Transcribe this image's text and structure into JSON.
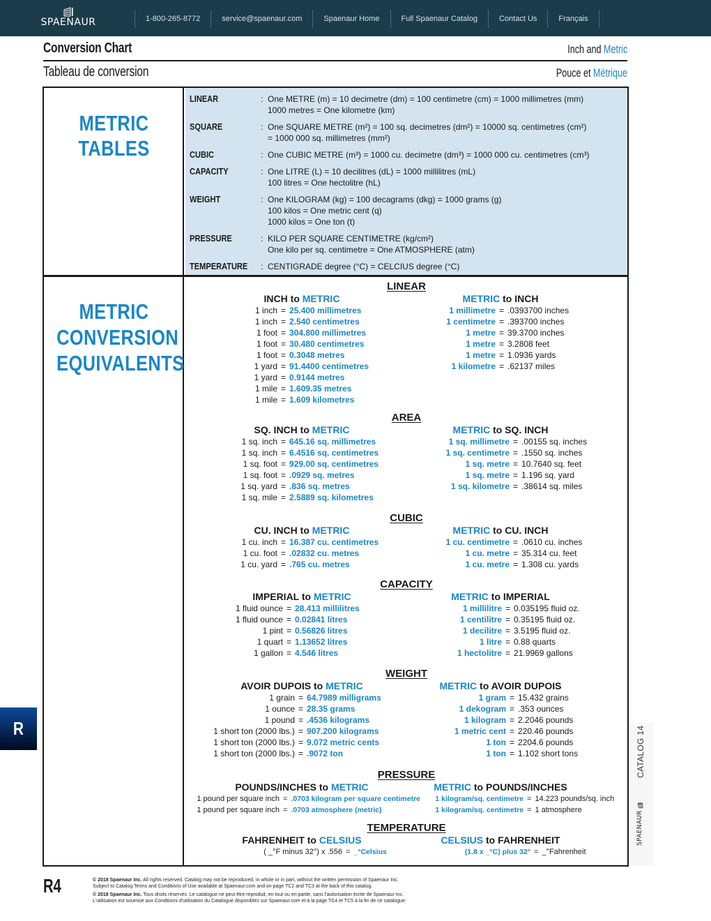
{
  "nav": {
    "brand": "SPAENAUR",
    "items": [
      "1-800-265-8772",
      "service@spaenaur.com",
      "Spaenaur Home",
      "Full Spaenaur Catalog",
      "Contact Us",
      "Français"
    ]
  },
  "header": {
    "title_en": "Conversion Chart",
    "title_fr": "Tableau de conversion",
    "subtitle_en": {
      "a": "Inch and ",
      "b": "Metric"
    },
    "subtitle_fr": {
      "a": "Pouce et ",
      "b": "Métrique"
    }
  },
  "colors": {
    "accent": "#1a86c8",
    "nav_bg": "#1b3c4a",
    "tables_bg": "#d3e3ef"
  },
  "metric_tables": {
    "heading": [
      "METRIC",
      "TABLES"
    ],
    "rows": [
      {
        "label": "LINEAR",
        "lines": [
          "One METRE (m) = 10 decimetre (dm) = 100 centimetre (cm) = 1000 millimetres (mm)",
          "1000 metres = One kilometre (km)"
        ]
      },
      {
        "label": "SQUARE",
        "lines": [
          "One SQUARE METRE (m²) = 100 sq. decimetres (dm²) = 10000 sq. centimetres (cm²)",
          "= 1000 000 sq. millimetres (mm²)"
        ]
      },
      {
        "label": "CUBIC",
        "lines": [
          "One CUBIC METRE (m³) = 1000 cu. decimetre (dm³) = 1000 000 cu. centimetres (cm³)"
        ]
      },
      {
        "label": "CAPACITY",
        "lines": [
          "One LITRE (L) = 10 decilitres (dL) = 1000 millilitres (mL)",
          "100 litres = One hectolitre (hL)"
        ]
      },
      {
        "label": "WEIGHT",
        "lines": [
          "One KILOGRAM (kg) = 100 decagrams (dkg) = 1000 grams (g)",
          "100 kilos = One metric cent (q)",
          "1000 kilos = One ton (t)"
        ]
      },
      {
        "label": "PRESSURE",
        "lines": [
          "KILO PER SQUARE CENTIMETRE (kg/cm²)",
          "One kilo per sq. centimetre = One ATMOSPHERE (atm)"
        ]
      },
      {
        "label": "TEMPERATURE",
        "lines": [
          "CENTIGRADE degree (°C) = CELCIUS degree (°C)"
        ]
      }
    ]
  },
  "equivalents": {
    "heading": [
      "METRIC",
      "CONVERSION",
      "EQUIVALENTS"
    ],
    "sections": [
      {
        "title": "LINEAR",
        "left_head": {
          "a": "INCH to ",
          "b": "METRIC"
        },
        "right_head": {
          "a": "METRIC",
          "b": " to INCH"
        },
        "left": [
          [
            "1 inch",
            "25.400 millimetres"
          ],
          [
            "1 inch",
            "2.540 centimetres"
          ],
          [
            "1 foot",
            "304.800 millimetres"
          ],
          [
            "1 foot",
            "30.480 centimetres"
          ],
          [
            "1 foot",
            "0.3048 metres"
          ],
          [
            "1 yard",
            "91.4400 centimetres"
          ],
          [
            "1 yard",
            "0.9144 metres"
          ],
          [
            "1 mile",
            "1.609.35 metres"
          ],
          [
            "1 mile",
            "1.609 kilometres"
          ]
        ],
        "right": [
          [
            "1 millimetre",
            ".0393700 inches"
          ],
          [
            "1 centimetre",
            " .393700 inches"
          ],
          [
            "1 metre",
            " 39.3700 inches"
          ],
          [
            "1 metre",
            " 3.2808 feet"
          ],
          [
            "1 metre",
            "1.0936 yards"
          ],
          [
            "1 kilometre",
            " .62137 miles"
          ]
        ]
      },
      {
        "title": "AREA",
        "left_head": {
          "a": "SQ. INCH to ",
          "b": "METRIC"
        },
        "right_head": {
          "a": "METRIC",
          "b": " to SQ. INCH"
        },
        "left": [
          [
            "1 sq. inch",
            "645.16 sq. millimetres"
          ],
          [
            "1 sq. inch",
            "6.4516 sq. centimetres"
          ],
          [
            "1 sq. foot",
            "929.00 sq. centimetres"
          ],
          [
            "1 sq. foot",
            ".0929 sq. metres"
          ],
          [
            "1 sq. yard",
            ".836 sq. metres"
          ],
          [
            "1 sq. mile",
            "2.5889 sq. kilometres"
          ]
        ],
        "right": [
          [
            "1 sq. millimetre",
            ".00155 sq. inches"
          ],
          [
            "1 sq. centimetre",
            ".1550 sq. inches"
          ],
          [
            "1 sq. metre",
            "10.7640 sq. feet"
          ],
          [
            "1 sq. metre",
            "1.196 sq. yard"
          ],
          [
            "1 sq. kilometre",
            ".38614 sq. miles"
          ]
        ]
      },
      {
        "title": "CUBIC",
        "left_head": {
          "a": "CU. INCH to ",
          "b": "METRIC"
        },
        "right_head": {
          "a": "METRIC",
          "b": " to CU. INCH"
        },
        "left": [
          [
            "1 cu. inch",
            "16.387 cu. centimetres"
          ],
          [
            "1 cu. foot",
            ".02832 cu. metres"
          ],
          [
            "1 cu. yard",
            ".765 cu. metres"
          ]
        ],
        "right": [
          [
            "1 cu. centimetre",
            ".0610 cu. inches"
          ],
          [
            "1 cu. metre",
            "35.314 cu. feet"
          ],
          [
            "1 cu. metre",
            "1.308 cu. yards"
          ]
        ]
      },
      {
        "title": "CAPACITY",
        "left_head": {
          "a": "IMPERIAL to ",
          "b": "METRIC"
        },
        "right_head": {
          "a": "METRIC",
          "b": " to IMPERIAL"
        },
        "left": [
          [
            "1 fluid ounce",
            "28.413 millilitres"
          ],
          [
            "1 fluid ounce",
            "0.02841 litres"
          ],
          [
            "1 pint",
            "0.56826 litres"
          ],
          [
            "1 quart",
            "1.13652 litres"
          ],
          [
            "1 gallon",
            "4.546 litres"
          ]
        ],
        "right": [
          [
            "1 millilitre",
            "0.035195 fluid oz."
          ],
          [
            "1 centilitre",
            "0.35195 fluid oz."
          ],
          [
            "1 decilitre",
            "3.5195 fluid oz."
          ],
          [
            "1 litre",
            "0.88 quarts"
          ],
          [
            "1 hectolitre",
            "21.9969 gallons"
          ]
        ]
      },
      {
        "title": "WEIGHT",
        "left_head": {
          "a": "AVOIR DUPOIS to ",
          "b": "METRIC"
        },
        "right_head": {
          "a": "METRIC",
          "b": " to AVOIR DUPOIS"
        },
        "left": [
          [
            "1 grain",
            "64.7989 milligrams"
          ],
          [
            "1 ounce",
            "28.35 grams"
          ],
          [
            "1 pound",
            ".4536 kilograms"
          ],
          [
            "1 short ton (2000 lbs.)",
            "907.200 kilograms"
          ],
          [
            "1 short ton (2000 lbs.)",
            "9.072 metric cents"
          ],
          [
            "1 short ton (2000 lbs.)",
            ".9072 ton"
          ]
        ],
        "right": [
          [
            "1 gram",
            "15.432 grains"
          ],
          [
            "1 dekogram",
            ".353 ounces"
          ],
          [
            "1 kilogram",
            "2.2046 pounds"
          ],
          [
            "1 metric cent",
            "220.46 pounds"
          ],
          [
            "1 ton",
            "2204.6 pounds"
          ],
          [
            "1 ton",
            "1.102 short tons"
          ]
        ]
      },
      {
        "title": "PRESSURE",
        "left_head": {
          "a": "POUNDS/INCHES to ",
          "b": "METRIC"
        },
        "right_head": {
          "a": "METRIC",
          "b": " to POUNDS/INCHES"
        },
        "left": [
          [
            "1 pound per square inch",
            ".0703 kilogram per square centimetre"
          ],
          [
            "1 pound per square inch",
            ".0703 atmosphere (metric)"
          ]
        ],
        "right": [
          [
            "1 kilogram/sq. centimetre",
            "14.223 pounds/sq. inch"
          ],
          [
            "1 kilogram/sq. centimetre",
            "1 atmosphere"
          ]
        ]
      },
      {
        "title": "TEMPERATURE",
        "left_head": {
          "a": "FAHRENHEIT to ",
          "b": "CELSIUS"
        },
        "right_head": {
          "a": "CELSIUS",
          "b": " to FAHRENHEIT"
        },
        "left": [
          [
            "( _°F minus 32°) x .556",
            "_°Celsius"
          ]
        ],
        "right": [
          [
            "(1.8 x _°C) plus 32°",
            "_°Fahrenheit"
          ]
        ]
      }
    ]
  },
  "side": {
    "section_tab": "R",
    "catalog": "CATALOG 14",
    "brand": "SPAENAUR"
  },
  "footer": {
    "page": "R4",
    "legal_en_bold": "© 2018 Spaenaur Inc.",
    "legal_en": " All rights reserved. Catalog may not be reproduced, in whole or in part, without the written permission of Spaenaur Inc.",
    "legal_en2": "Subject to Catalog Terms and Conditions of Use available at Spaenaur.com and on page TC2 and TC3 at the back of this catalog.",
    "legal_fr_bold": "© 2018 Spaenaur Inc.",
    "legal_fr": " Tous droits réservés. Le catalogue ne peut être reproduit, en tout ou en partie, sans l'autorisation écrite de Spaenaur Inc.",
    "legal_fr2": "L'utilisation est soumise aux Conditions d'utilisation du Catalogue disponibles sur Spaenaur.com et à la page TC4 et TC5 à la fin de ce catalogue."
  }
}
